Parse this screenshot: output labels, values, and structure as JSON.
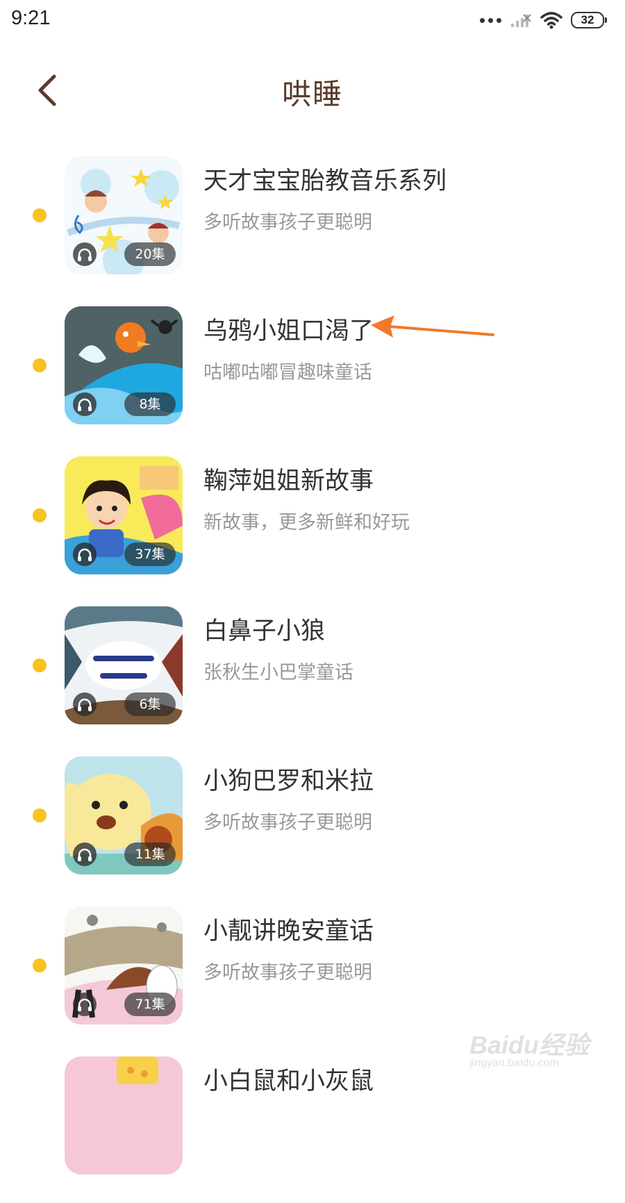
{
  "status_bar": {
    "time": "9:21",
    "battery": "32"
  },
  "header": {
    "title": "哄睡"
  },
  "items": [
    {
      "title": "天才宝宝胎教音乐系列",
      "subtitle": "多听故事孩子更聪明",
      "episodes": "20集"
    },
    {
      "title": "乌鸦小姐口渴了",
      "subtitle": "咕嘟咕嘟冒趣味童话",
      "episodes": "8集"
    },
    {
      "title": "鞠萍姐姐新故事",
      "subtitle": "新故事，更多新鲜和好玩",
      "episodes": "37集"
    },
    {
      "title": "白鼻子小狼",
      "subtitle": "张秋生小巴掌童话",
      "episodes": "6集"
    },
    {
      "title": "小狗巴罗和米拉",
      "subtitle": "多听故事孩子更聪明",
      "episodes": "11集"
    },
    {
      "title": "小靓讲晚安童话",
      "subtitle": "多听故事孩子更聪明",
      "episodes": "71集"
    },
    {
      "title": "小白鼠和小灰鼠",
      "subtitle": "",
      "episodes": ""
    }
  ],
  "watermark": {
    "text": "Baidu经验",
    "sub": "jingyan.baidu.com"
  },
  "colors": {
    "accent_dot": "#f8c21f",
    "title": "#5a3a2a",
    "arrow": "#f07a2a"
  }
}
